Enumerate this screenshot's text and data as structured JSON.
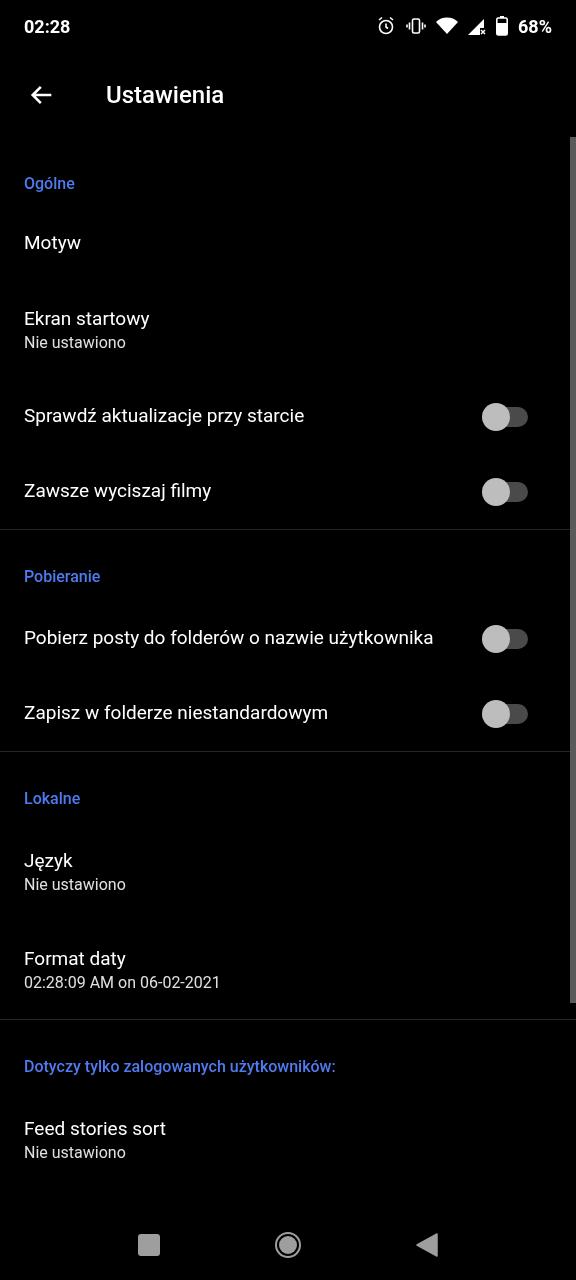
{
  "status_bar": {
    "time": "02:28",
    "battery": "68%"
  },
  "toolbar": {
    "title": "Ustawienia"
  },
  "sections": [
    {
      "header": "Ogólne",
      "items": [
        {
          "kind": "plain",
          "title": "Motyw"
        },
        {
          "kind": "summary",
          "title": "Ekran startowy",
          "summary": "Nie ustawiono"
        },
        {
          "kind": "switch",
          "title": "Sprawdź aktualizacje przy starcie",
          "on": false
        },
        {
          "kind": "switch",
          "title": "Zawsze wyciszaj filmy",
          "on": false
        }
      ]
    },
    {
      "header": "Pobieranie",
      "items": [
        {
          "kind": "switch",
          "title": "Pobierz posty do folderów o nazwie użytkownika",
          "on": false
        },
        {
          "kind": "switch",
          "title": "Zapisz w folderze niestandardowym",
          "on": false
        }
      ]
    },
    {
      "header": "Lokalne",
      "items": [
        {
          "kind": "summary",
          "title": "Język",
          "summary": "Nie ustawiono"
        },
        {
          "kind": "summary",
          "title": "Format daty",
          "summary": "02:28:09 AM on 06-02-2021"
        }
      ]
    },
    {
      "header": "Dotyczy tylko zalogowanych użytkowników:",
      "items": [
        {
          "kind": "summary",
          "title": "Feed stories sort",
          "summary": "Nie ustawiono"
        }
      ]
    }
  ]
}
